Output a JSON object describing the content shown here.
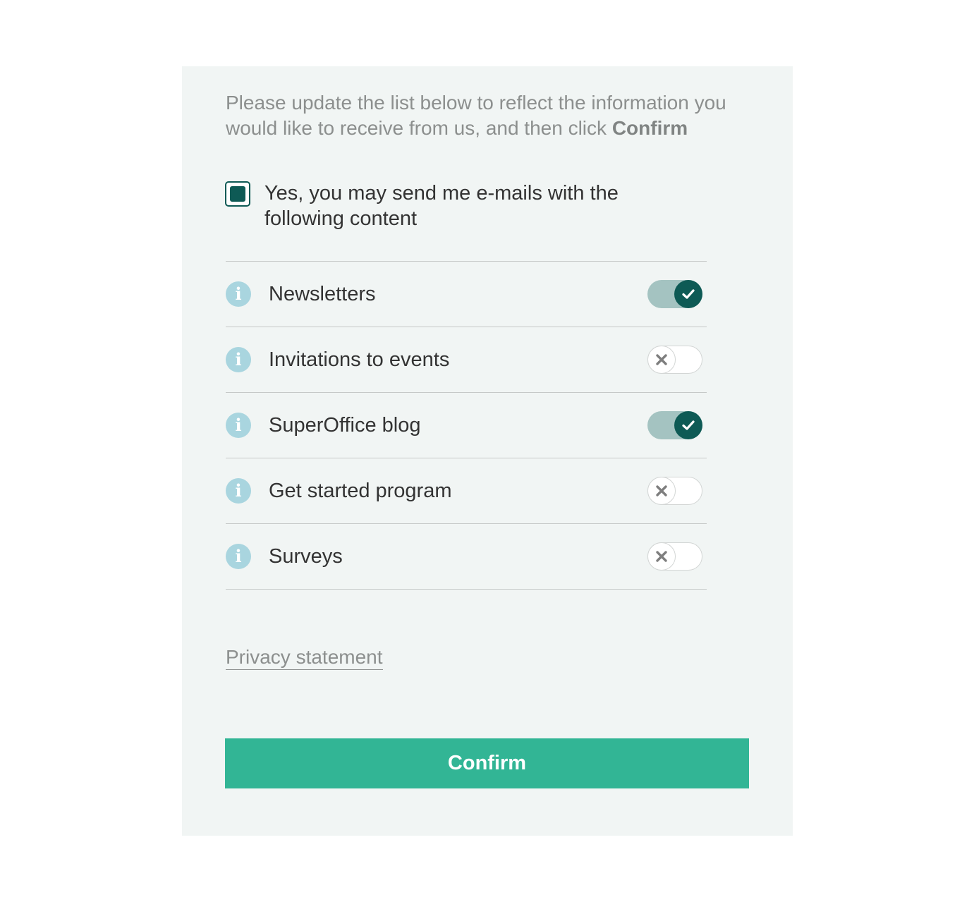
{
  "intro": {
    "text": "Please update the list below to reflect the information you would like to receive from us, and then click ",
    "emphasis": "Confirm"
  },
  "consent": {
    "label": "Yes, you may send me e-mails with the following content",
    "checked": true
  },
  "subscriptions": [
    {
      "label": "Newsletters",
      "enabled": true
    },
    {
      "label": "Invitations to events",
      "enabled": false
    },
    {
      "label": "SuperOffice blog",
      "enabled": true
    },
    {
      "label": "Get started program",
      "enabled": false
    },
    {
      "label": "Surveys",
      "enabled": false
    }
  ],
  "info_icon_glyph": "i",
  "privacy_link": "Privacy statement",
  "confirm_button": "Confirm",
  "colors": {
    "panel_bg": "#f1f5f4",
    "accent_dark": "#0e5a55",
    "toggle_on_track": "#a4c3c1",
    "info_icon": "#a9d5df",
    "confirm_bg": "#32b595"
  }
}
